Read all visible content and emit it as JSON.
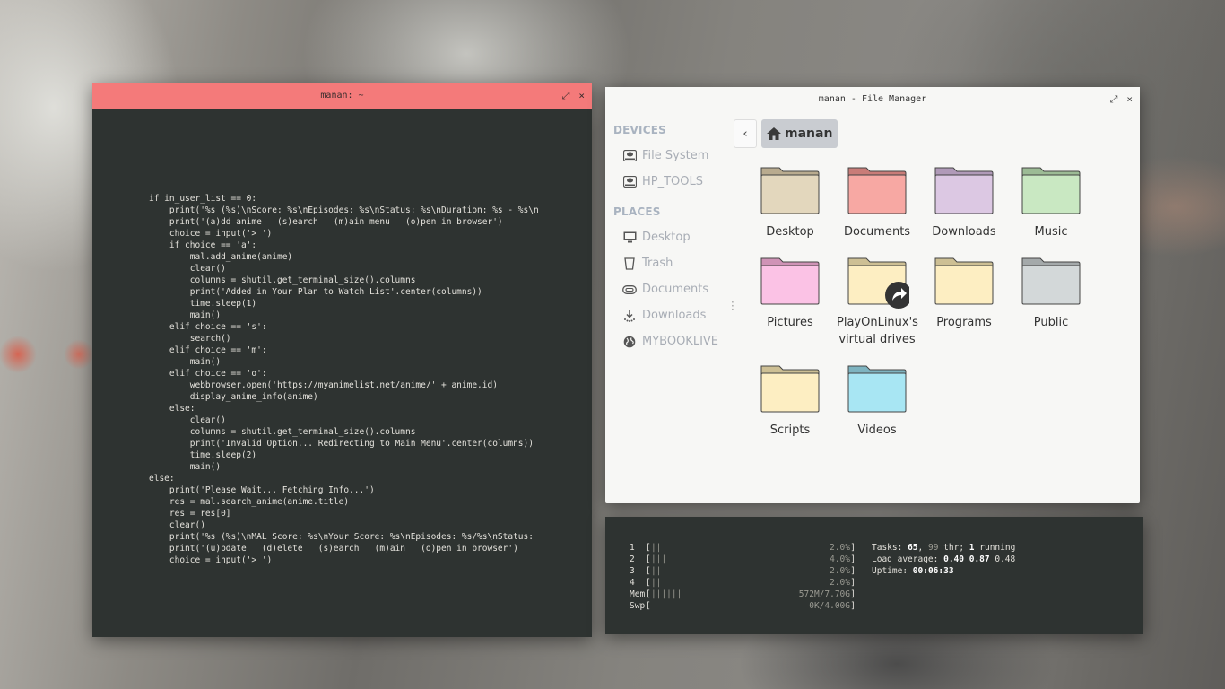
{
  "terminal": {
    "title": "manan: ~",
    "maximize_icon": "⤢",
    "close_icon": "×",
    "accent_color": "#f47a7a",
    "code_lines": [
      "if in_user_list == 0:",
      "    print('%s (%s)\\nScore: %s\\nEpisodes: %s\\nStatus: %s\\nDuration: %s - %s\\n",
      "    print('(a)dd anime   (s)earch   (m)ain menu   (o)pen in browser')",
      "    choice = input('> ')",
      "    if choice == 'a':",
      "        mal.add_anime(anime)",
      "        clear()",
      "        columns = shutil.get_terminal_size().columns",
      "        print('Added in Your Plan to Watch List'.center(columns))",
      "        time.sleep(1)",
      "        main()",
      "    elif choice == 's':",
      "        search()",
      "    elif choice == 'm':",
      "        main()",
      "    elif choice == 'o':",
      "        webbrowser.open('https://myanimelist.net/anime/' + anime.id)",
      "        display_anime_info(anime)",
      "    else:",
      "        clear()",
      "        columns = shutil.get_terminal_size().columns",
      "        print('Invalid Option... Redirecting to Main Menu'.center(columns))",
      "        time.sleep(2)",
      "        main()",
      "else:",
      "    print('Please Wait... Fetching Info...')",
      "    res = mal.search_anime(anime.title)",
      "    res = res[0]",
      "    clear()",
      "    print('%s (%s)\\nMAL Score: %s\\nYour Score: %s\\nEpisodes: %s/%s\\nStatus:",
      "    print('(u)pdate   (d)elete   (s)earch   (m)ain   (o)pen in browser')",
      "    choice = input('> ')"
    ]
  },
  "file_manager": {
    "title": "manan - File Manager",
    "maximize_icon": "⤢",
    "close_icon": "×",
    "sidebar": {
      "devices_heading": "DEVICES",
      "devices": [
        {
          "label": "File System",
          "icon": "drive-icon"
        },
        {
          "label": "HP_TOOLS",
          "icon": "drive-icon"
        }
      ],
      "places_heading": "PLACES",
      "places": [
        {
          "label": "Desktop",
          "icon": "monitor-icon"
        },
        {
          "label": "Trash",
          "icon": "trash-icon"
        },
        {
          "label": "Documents",
          "icon": "paperclip-icon"
        },
        {
          "label": "Downloads",
          "icon": "download-icon"
        },
        {
          "label": "MYBOOKLIVE",
          "icon": "globe-icon"
        }
      ]
    },
    "back_icon": "‹",
    "breadcrumb": "manan",
    "folders": [
      {
        "label": "Desktop",
        "color": "#e3d7bd",
        "tab": "#b9ab8f"
      },
      {
        "label": "Documents",
        "color": "#f7a8a3",
        "tab": "#c97c78"
      },
      {
        "label": "Downloads",
        "color": "#dcc8e3",
        "tab": "#b09ab8"
      },
      {
        "label": "Music",
        "color": "#c9e8c2",
        "tab": "#9cbb95"
      },
      {
        "label": "Pictures",
        "color": "#fbc2e5",
        "tab": "#cf93b6"
      },
      {
        "label": "PlayOnLinux's virtual drives",
        "color": "#fdeec2",
        "tab": "#cdbf94",
        "link": true
      },
      {
        "label": "Programs",
        "color": "#fdeec2",
        "tab": "#cdbf94"
      },
      {
        "label": "Public",
        "color": "#d3d8d9",
        "tab": "#a4a9aa"
      },
      {
        "label": "Scripts",
        "color": "#fdeec2",
        "tab": "#cdbf94"
      },
      {
        "label": "Videos",
        "color": "#a8e6f3",
        "tab": "#7eb4c0"
      }
    ]
  },
  "htop": {
    "meters": [
      {
        "name": "1",
        "bars": "||",
        "value": "2.0%",
        "percent": 2.0
      },
      {
        "name": "2",
        "bars": "|||",
        "value": "4.0%",
        "percent": 4.0
      },
      {
        "name": "3",
        "bars": "||",
        "value": "2.0%",
        "percent": 2.0
      },
      {
        "name": "4",
        "bars": "||",
        "value": "2.0%",
        "percent": 2.0
      },
      {
        "name": "Mem",
        "bars": "||||||",
        "value": "572M/7.70G"
      },
      {
        "name": "Swp",
        "bars": "",
        "value": "0K/4.00G"
      }
    ],
    "tasks_label": "Tasks:",
    "tasks_count": "65",
    "threads_count": "99",
    "threads_label": "thr;",
    "running_count": "1",
    "running_label": "running",
    "load_label": "Load average:",
    "load_1": "0.40",
    "load_5": "0.87",
    "load_15": "0.48",
    "uptime_label": "Uptime:",
    "uptime": "00:06:33"
  }
}
